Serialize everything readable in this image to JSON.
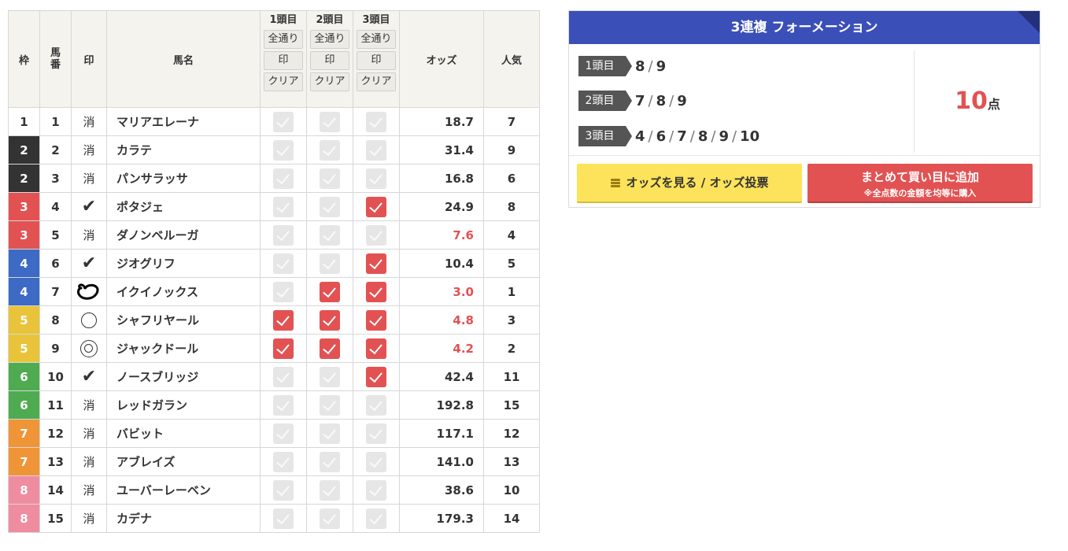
{
  "table": {
    "headers": {
      "waku": "枠",
      "umaban": "馬番",
      "mark": "印",
      "name": "馬名",
      "odds": "オッズ",
      "popularity": "人気",
      "legs": [
        {
          "label": "1頭目",
          "all": "全通り",
          "mark": "印",
          "clear": "クリア"
        },
        {
          "label": "2頭目",
          "all": "全通り",
          "mark": "印",
          "clear": "クリア"
        },
        {
          "label": "3頭目",
          "all": "全通り",
          "mark": "印",
          "clear": "クリア"
        }
      ]
    },
    "waku_colors": {
      "1": {
        "bg": "#ffffff",
        "fg": "#333333"
      },
      "2": {
        "bg": "#333333",
        "fg": "#ffffff"
      },
      "3": {
        "bg": "#e25253",
        "fg": "#ffffff"
      },
      "4": {
        "bg": "#3c6ac4",
        "fg": "#ffffff"
      },
      "5": {
        "bg": "#e9c43a",
        "fg": "#ffffff"
      },
      "6": {
        "bg": "#4fab4f",
        "fg": "#ffffff"
      },
      "7": {
        "bg": "#ef9437",
        "fg": "#ffffff"
      },
      "8": {
        "bg": "#f08ca0",
        "fg": "#ffffff"
      }
    },
    "rows": [
      {
        "waku": "1",
        "num": "1",
        "mark": "消",
        "mark_type": "text",
        "name": "マリアエレーナ",
        "leg1": false,
        "leg2": false,
        "leg3": false,
        "odds": "18.7",
        "hot": false,
        "pop": "7"
      },
      {
        "waku": "2",
        "num": "2",
        "mark": "消",
        "mark_type": "text",
        "name": "カラテ",
        "leg1": false,
        "leg2": false,
        "leg3": false,
        "odds": "31.4",
        "hot": false,
        "pop": "9"
      },
      {
        "waku": "2",
        "num": "3",
        "mark": "消",
        "mark_type": "text",
        "name": "パンサラッサ",
        "leg1": false,
        "leg2": false,
        "leg3": false,
        "odds": "16.8",
        "hot": false,
        "pop": "6"
      },
      {
        "waku": "3",
        "num": "4",
        "mark": "",
        "mark_type": "check",
        "name": "ポタジェ",
        "leg1": false,
        "leg2": false,
        "leg3": true,
        "odds": "24.9",
        "hot": false,
        "pop": "8"
      },
      {
        "waku": "3",
        "num": "5",
        "mark": "消",
        "mark_type": "text",
        "name": "ダノンベルーガ",
        "leg1": false,
        "leg2": false,
        "leg3": false,
        "odds": "7.6",
        "hot": true,
        "pop": "4"
      },
      {
        "waku": "4",
        "num": "6",
        "mark": "",
        "mark_type": "check",
        "name": "ジオグリフ",
        "leg1": false,
        "leg2": false,
        "leg3": true,
        "odds": "10.4",
        "hot": false,
        "pop": "5"
      },
      {
        "waku": "4",
        "num": "7",
        "mark": "",
        "mark_type": "heart",
        "name": "イクイノックス",
        "leg1": false,
        "leg2": true,
        "leg3": true,
        "odds": "3.0",
        "hot": true,
        "pop": "1"
      },
      {
        "waku": "5",
        "num": "8",
        "mark": "",
        "mark_type": "circle",
        "name": "シャフリヤール",
        "leg1": true,
        "leg2": true,
        "leg3": true,
        "odds": "4.8",
        "hot": true,
        "pop": "3"
      },
      {
        "waku": "5",
        "num": "9",
        "mark": "",
        "mark_type": "dcircle",
        "name": "ジャックドール",
        "leg1": true,
        "leg2": true,
        "leg3": true,
        "odds": "4.2",
        "hot": true,
        "pop": "2"
      },
      {
        "waku": "6",
        "num": "10",
        "mark": "",
        "mark_type": "check",
        "name": "ノースブリッジ",
        "leg1": false,
        "leg2": false,
        "leg3": true,
        "odds": "42.4",
        "hot": false,
        "pop": "11"
      },
      {
        "waku": "6",
        "num": "11",
        "mark": "消",
        "mark_type": "text",
        "name": "レッドガラン",
        "leg1": false,
        "leg2": false,
        "leg3": false,
        "odds": "192.8",
        "hot": false,
        "pop": "15"
      },
      {
        "waku": "7",
        "num": "12",
        "mark": "消",
        "mark_type": "text",
        "name": "バビット",
        "leg1": false,
        "leg2": false,
        "leg3": false,
        "odds": "117.1",
        "hot": false,
        "pop": "12"
      },
      {
        "waku": "7",
        "num": "13",
        "mark": "消",
        "mark_type": "text",
        "name": "アブレイズ",
        "leg1": false,
        "leg2": false,
        "leg3": false,
        "odds": "141.0",
        "hot": false,
        "pop": "13"
      },
      {
        "waku": "8",
        "num": "14",
        "mark": "消",
        "mark_type": "text",
        "name": "ユーバーレーベン",
        "leg1": false,
        "leg2": false,
        "leg3": false,
        "odds": "38.6",
        "hot": false,
        "pop": "10"
      },
      {
        "waku": "8",
        "num": "15",
        "mark": "消",
        "mark_type": "text",
        "name": "カデナ",
        "leg1": false,
        "leg2": false,
        "leg3": false,
        "odds": "179.3",
        "hot": false,
        "pop": "14"
      }
    ]
  },
  "formation": {
    "title": "3連複 フォーメーション",
    "rows": [
      {
        "tag": "1頭目",
        "values": [
          "8",
          "9"
        ]
      },
      {
        "tag": "2頭目",
        "values": [
          "7",
          "8",
          "9"
        ]
      },
      {
        "tag": "3頭目",
        "values": [
          "4",
          "6",
          "7",
          "8",
          "9",
          "10"
        ]
      }
    ],
    "separator": "/",
    "count": "10",
    "count_unit": "点",
    "odds_button": "オッズを見る / オッズ投票",
    "add_button": "まとめて買い目に追加",
    "add_button_note": "※全点数の金額を均等に購入"
  }
}
